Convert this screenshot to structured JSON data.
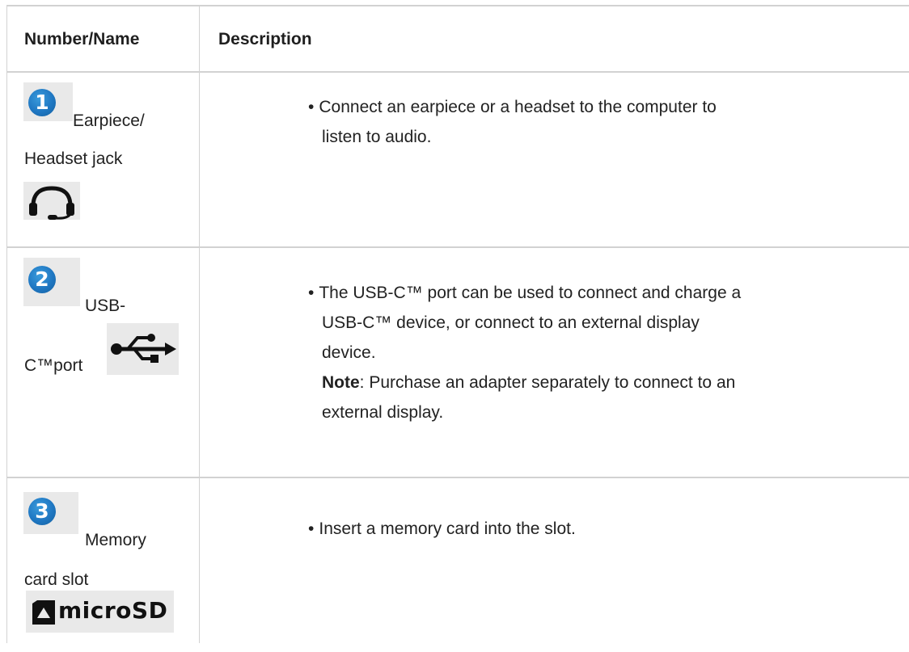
{
  "table": {
    "headers": {
      "name": "Number/Name",
      "description": "Description"
    },
    "rows": [
      {
        "number": "1",
        "name_lines": [
          "Earpiece/",
          "Headset jack"
        ],
        "icon": "headset-icon",
        "description": "Connect an earpiece or a headset to the computer to listen to audio.",
        "desc_lines": [
          "Connect an earpiece or a headset to the computer to",
          "listen to audio."
        ]
      },
      {
        "number": "2",
        "name_lines": [
          "USB-",
          "C™port"
        ],
        "icon": "usb-icon",
        "desc_lines": [
          "The USB-C™ port can be used to connect and charge a",
          "USB-C™ device, or connect to an external display",
          "device."
        ],
        "note_label": "Note",
        "note_lines": [
          ": Purchase an adapter separately to connect to an",
          "external display."
        ]
      },
      {
        "number": "3",
        "name_lines": [
          "Memory",
          "card slot"
        ],
        "icon": "microsd-icon",
        "icon_text": "microSD",
        "desc_lines": [
          "Insert a memory card into the slot."
        ]
      }
    ]
  },
  "colors": {
    "badge": "#1f77c2",
    "border": "#d2d2d2",
    "icon_bg": "#e9e9e9"
  }
}
